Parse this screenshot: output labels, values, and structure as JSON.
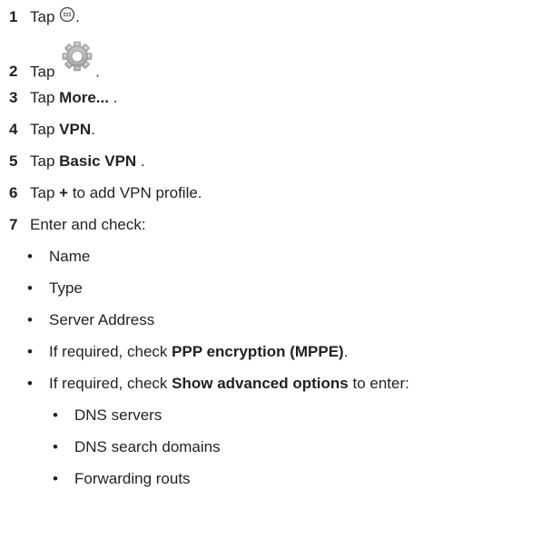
{
  "steps": [
    {
      "num": "1",
      "pre": "Tap",
      "icon": "apps-grid-icon",
      "post": "."
    },
    {
      "num": "2",
      "pre": "Tap",
      "icon": "settings-gear-icon",
      "post": "."
    },
    {
      "num": "3",
      "pre": "Tap",
      "bold": "More...",
      "post": "."
    },
    {
      "num": "4",
      "pre": "Tap",
      "bold": "VPN",
      "post": "."
    },
    {
      "num": "5",
      "pre": "Tap",
      "bold": "Basic VPN",
      "post": "."
    },
    {
      "num": "6",
      "pre": "Tap",
      "bold": "+",
      "post": "to add VPN profile."
    },
    {
      "num": "7",
      "text": "Enter and check:"
    }
  ],
  "bullets": {
    "symbol": "•",
    "name": "Name",
    "type": "Type",
    "server": "Server Address",
    "ppp_pre": "If required, check",
    "ppp_bold": "PPP encryption (MPPE)",
    "ppp_post": ".",
    "adv_pre": "If required, check",
    "adv_bold": "Show advanced options",
    "adv_post": "to enter:"
  },
  "sub_bullets": {
    "dns": "DNS servers",
    "dns_search": "DNS search domains",
    "forwarding": "Forwarding routs"
  }
}
